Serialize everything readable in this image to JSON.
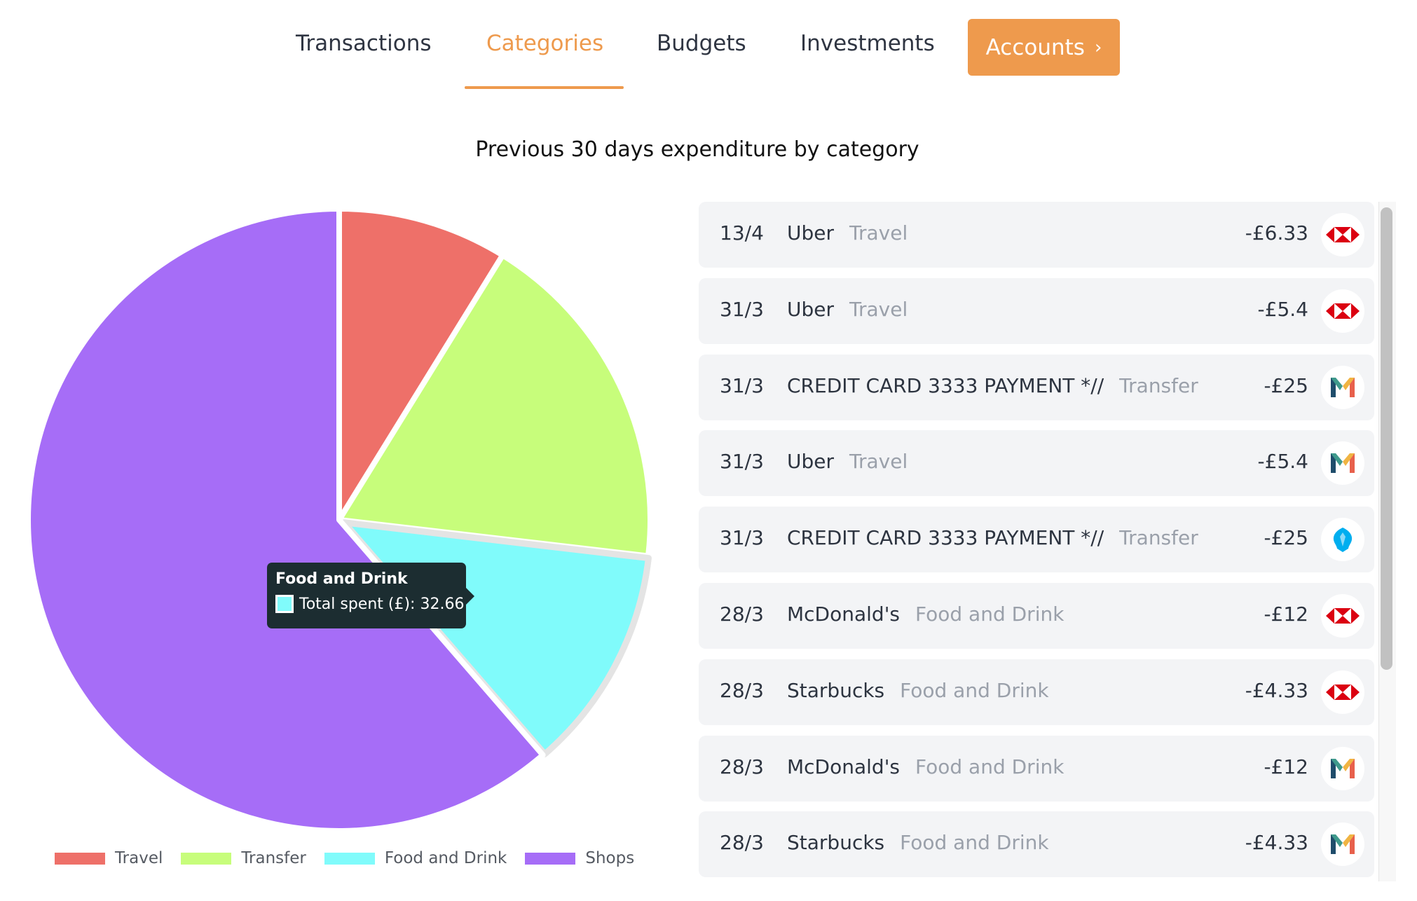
{
  "nav": {
    "tabs": [
      {
        "label": "Transactions",
        "active": false
      },
      {
        "label": "Categories",
        "active": true
      },
      {
        "label": "Budgets",
        "active": false
      },
      {
        "label": "Investments",
        "active": false
      }
    ],
    "accounts_button": "Accounts",
    "accounts_chevron": "›",
    "accent_color": "#ee9a4d"
  },
  "chart_data": {
    "type": "pie",
    "title": "Previous 30 days expenditure by category",
    "categories": [
      "Travel",
      "Transfer",
      "Food and Drink",
      "Shops"
    ],
    "values": [
      24.4,
      50,
      32.66,
      170
    ],
    "colors": [
      "#ee7069",
      "#c7fd7b",
      "#80fbfb",
      "#a66df7"
    ],
    "highlighted": "Food and Drink",
    "legend_position": "bottom"
  },
  "tooltip": {
    "title": "Food and Drink",
    "label": "Total spent (£): 32.66"
  },
  "transactions": [
    {
      "date": "13/4",
      "merchant": "Uber",
      "category": "Travel",
      "amount": "-£6.33",
      "bank": "hsbc-icon"
    },
    {
      "date": "31/3",
      "merchant": "Uber",
      "category": "Travel",
      "amount": "-£5.4",
      "bank": "hsbc-icon"
    },
    {
      "date": "31/3",
      "merchant": "CREDIT CARD 3333 PAYMENT *//",
      "category": "Transfer",
      "amount": "-£25",
      "bank": "monzo-icon"
    },
    {
      "date": "31/3",
      "merchant": "Uber",
      "category": "Travel",
      "amount": "-£5.4",
      "bank": "monzo-icon"
    },
    {
      "date": "31/3",
      "merchant": "CREDIT CARD 3333 PAYMENT *//",
      "category": "Transfer",
      "amount": "-£25",
      "bank": "barclays-icon"
    },
    {
      "date": "28/3",
      "merchant": "McDonald's",
      "category": "Food and Drink",
      "amount": "-£12",
      "bank": "hsbc-icon"
    },
    {
      "date": "28/3",
      "merchant": "Starbucks",
      "category": "Food and Drink",
      "amount": "-£4.33",
      "bank": "hsbc-icon"
    },
    {
      "date": "28/3",
      "merchant": "McDonald's",
      "category": "Food and Drink",
      "amount": "-£12",
      "bank": "monzo-icon"
    },
    {
      "date": "28/3",
      "merchant": "Starbucks",
      "category": "Food and Drink",
      "amount": "-£4.33",
      "bank": "monzo-icon"
    }
  ]
}
